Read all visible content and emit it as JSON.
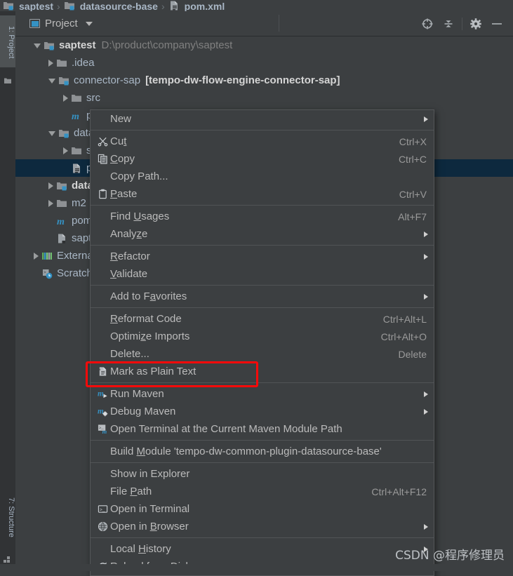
{
  "breadcrumb": {
    "items": [
      {
        "label": "saptest",
        "icon": "module-folder-icon"
      },
      {
        "label": "datasource-base",
        "icon": "module-folder-icon"
      },
      {
        "label": "pom.xml",
        "icon": "maven-pom-file-icon"
      }
    ],
    "separator": "›"
  },
  "leftbar": {
    "top_tab": "1: Project",
    "bottom_tab": "7: Structure",
    "top_icon": "folder-icon",
    "bottom_icon": "structure-icon"
  },
  "toolwindow": {
    "title": "Project",
    "title_icon": "project-view-icon",
    "actions": [
      {
        "name": "scroll-from-source-icon",
        "tooltip": "Select Opened File"
      },
      {
        "name": "collapse-all-icon",
        "tooltip": "Collapse All"
      },
      {
        "name": "gear-icon",
        "tooltip": "Settings"
      },
      {
        "name": "minimize-icon",
        "tooltip": "Hide"
      }
    ]
  },
  "tree": {
    "rows": [
      {
        "indent": 0,
        "arrow": "open",
        "icon": "module-folder-icon",
        "label": "saptest",
        "bold": true,
        "path": "D:\\product\\company\\saptest"
      },
      {
        "indent": 1,
        "arrow": "closed",
        "icon": "folder-icon",
        "label": ".idea",
        "bold": false,
        "path": ""
      },
      {
        "indent": 1,
        "arrow": "open",
        "icon": "module-folder-icon",
        "label": "connector-sap",
        "bold": false,
        "module": "[tempo-dw-flow-engine-connector-sap]"
      },
      {
        "indent": 2,
        "arrow": "closed",
        "icon": "folder-icon",
        "label": "src",
        "bold": false,
        "path": ""
      },
      {
        "indent": 2,
        "arrow": "none",
        "icon": "maven-m-icon",
        "label": "pom.xml",
        "bold": false,
        "path": ""
      },
      {
        "indent": 1,
        "arrow": "open",
        "icon": "module-folder-icon",
        "label": "datasource-base",
        "bold": false,
        "path": ""
      },
      {
        "indent": 2,
        "arrow": "closed",
        "icon": "folder-icon",
        "label": "src",
        "bold": false,
        "path": ""
      },
      {
        "indent": 2,
        "arrow": "none",
        "icon": "xml-file-icon",
        "label": "pom.xml",
        "bold": false,
        "path": "",
        "selected": true
      },
      {
        "indent": 1,
        "arrow": "closed",
        "icon": "module-folder-icon",
        "label": "datasource-db",
        "bold": true,
        "path": ""
      },
      {
        "indent": 1,
        "arrow": "closed",
        "icon": "folder-icon",
        "label": "m2",
        "bold": false,
        "path": ""
      },
      {
        "indent": 1,
        "arrow": "none",
        "icon": "maven-m-icon",
        "label": "pom.xml",
        "bold": false,
        "path": ""
      },
      {
        "indent": 1,
        "arrow": "none",
        "icon": "file-icon",
        "label": "saptest.iml",
        "bold": false,
        "path": ""
      },
      {
        "indent": 0,
        "arrow": "closed",
        "icon": "external-libraries-icon",
        "label": "External Libraries",
        "bold": false,
        "path": ""
      },
      {
        "indent": 0,
        "arrow": "none",
        "icon": "scratches-icon",
        "label": "Scratches and Consoles",
        "bold": false,
        "path": ""
      }
    ]
  },
  "context_menu": {
    "groups": [
      {
        "items": [
          {
            "label": "New",
            "mnemonic": "",
            "accel": "",
            "submenu": true,
            "icon": ""
          }
        ]
      },
      {
        "items": [
          {
            "label": "Cut",
            "mnemonic": "t",
            "accel": "Ctrl+X",
            "submenu": false,
            "icon": "scissors-icon"
          },
          {
            "label": "Copy",
            "mnemonic": "C",
            "accel": "Ctrl+C",
            "submenu": false,
            "icon": "copy-icon"
          },
          {
            "label": "Copy Path...",
            "mnemonic": "",
            "accel": "",
            "submenu": false,
            "icon": ""
          },
          {
            "label": "Paste",
            "mnemonic": "P",
            "accel": "Ctrl+V",
            "submenu": false,
            "icon": "clipboard-icon"
          }
        ]
      },
      {
        "items": [
          {
            "label": "Find Usages",
            "mnemonic": "U",
            "accel": "Alt+F7",
            "submenu": false,
            "icon": ""
          },
          {
            "label": "Analyze",
            "mnemonic": "z",
            "accel": "",
            "submenu": true,
            "icon": ""
          }
        ]
      },
      {
        "items": [
          {
            "label": "Refactor",
            "mnemonic": "R",
            "accel": "",
            "submenu": true,
            "icon": ""
          },
          {
            "label": "Validate",
            "mnemonic": "V",
            "accel": "",
            "submenu": false,
            "icon": ""
          }
        ]
      },
      {
        "items": [
          {
            "label": "Add to Favorites",
            "mnemonic": "a",
            "accel": "",
            "submenu": true,
            "icon": ""
          }
        ]
      },
      {
        "items": [
          {
            "label": "Reformat Code",
            "mnemonic": "R",
            "accel": "Ctrl+Alt+L",
            "submenu": false,
            "icon": ""
          },
          {
            "label": "Optimize Imports",
            "mnemonic": "z",
            "accel": "Ctrl+Alt+O",
            "submenu": false,
            "icon": ""
          },
          {
            "label": "Delete...",
            "mnemonic": "",
            "accel": "Delete",
            "submenu": false,
            "icon": ""
          },
          {
            "label": "Mark as Plain Text",
            "mnemonic": "",
            "accel": "",
            "submenu": false,
            "icon": "plain-text-icon",
            "highlighted": true
          }
        ]
      },
      {
        "items": [
          {
            "label": "Run Maven",
            "mnemonic": "",
            "accel": "",
            "submenu": true,
            "icon": "run-maven-icon"
          },
          {
            "label": "Debug Maven",
            "mnemonic": "",
            "accel": "",
            "submenu": true,
            "icon": "debug-maven-icon"
          },
          {
            "label": "Open Terminal at the Current Maven Module Path",
            "mnemonic": "",
            "accel": "",
            "submenu": false,
            "icon": "terminal-maven-icon"
          }
        ]
      },
      {
        "items": [
          {
            "label": "Build Module 'tempo-dw-common-plugin-datasource-base'",
            "mnemonic": "M",
            "accel": "",
            "submenu": false,
            "icon": ""
          }
        ]
      },
      {
        "items": [
          {
            "label": "Show in Explorer",
            "mnemonic": "",
            "accel": "",
            "submenu": false,
            "icon": ""
          },
          {
            "label": "File Path",
            "mnemonic": "P",
            "accel": "Ctrl+Alt+F12",
            "submenu": false,
            "icon": ""
          },
          {
            "label": "Open in Terminal",
            "mnemonic": "",
            "accel": "",
            "submenu": false,
            "icon": "terminal-icon"
          },
          {
            "label": "Open in Browser",
            "mnemonic": "B",
            "accel": "",
            "submenu": true,
            "icon": "globe-icon"
          }
        ]
      },
      {
        "items": [
          {
            "label": "Local History",
            "mnemonic": "H",
            "accel": "",
            "submenu": true,
            "icon": ""
          },
          {
            "label": "Reload from Disk",
            "mnemonic": "",
            "accel": "",
            "submenu": false,
            "icon": "reload-icon"
          }
        ]
      }
    ]
  },
  "annotation": {
    "target_label": "Mark as Plain Text",
    "color": "#fb0a0a"
  },
  "watermark": {
    "text": "CSDN @程序修理员"
  },
  "colors": {
    "background": "#3c3f41",
    "panel": "#313335",
    "selection": "#0d293e",
    "text": "#a9b7c6",
    "accent": "#3592c4",
    "annotation": "#fb0a0a"
  }
}
